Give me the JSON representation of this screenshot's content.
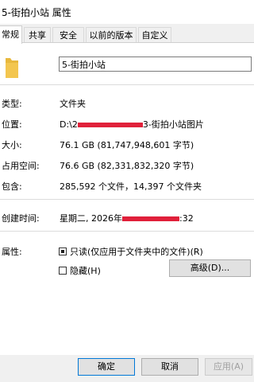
{
  "window": {
    "title": "5-街拍小站 属性"
  },
  "tabs": [
    {
      "label": "常规"
    },
    {
      "label": "共享"
    },
    {
      "label": "安全"
    },
    {
      "label": "以前的版本"
    },
    {
      "label": "自定义"
    }
  ],
  "general": {
    "icon": "folder-icon",
    "name": "5-街拍小站",
    "type_label": "类型:",
    "type_value": "文件夹",
    "location_label": "位置:",
    "location_prefix": "D:\\2",
    "location_suffix": "3-街拍小站图片",
    "size_label": "大小:",
    "size_value": "76.1 GB (81,747,948,601 字节)",
    "disk_size_label": "占用空间:",
    "disk_size_value": "76.6 GB (82,331,832,320 字节)",
    "contains_label": "包含:",
    "contains_value": "285,592 个文件，14,397 个文件夹",
    "created_label": "创建时间:",
    "created_prefix": "星期二, 2026年",
    "created_suffix": ":32",
    "attributes_label": "属性:",
    "readonly_label": "只读(仅应用于文件夹中的文件)(R)",
    "hidden_label": "隐藏(H)",
    "advanced_button": "高级(D)..."
  },
  "footer": {
    "ok": "确定",
    "cancel": "取消",
    "apply": "应用(A)"
  },
  "colors": {
    "redaction": "#e0203a",
    "folder": "#f3c64f",
    "default_button_border": "#0078d7"
  }
}
